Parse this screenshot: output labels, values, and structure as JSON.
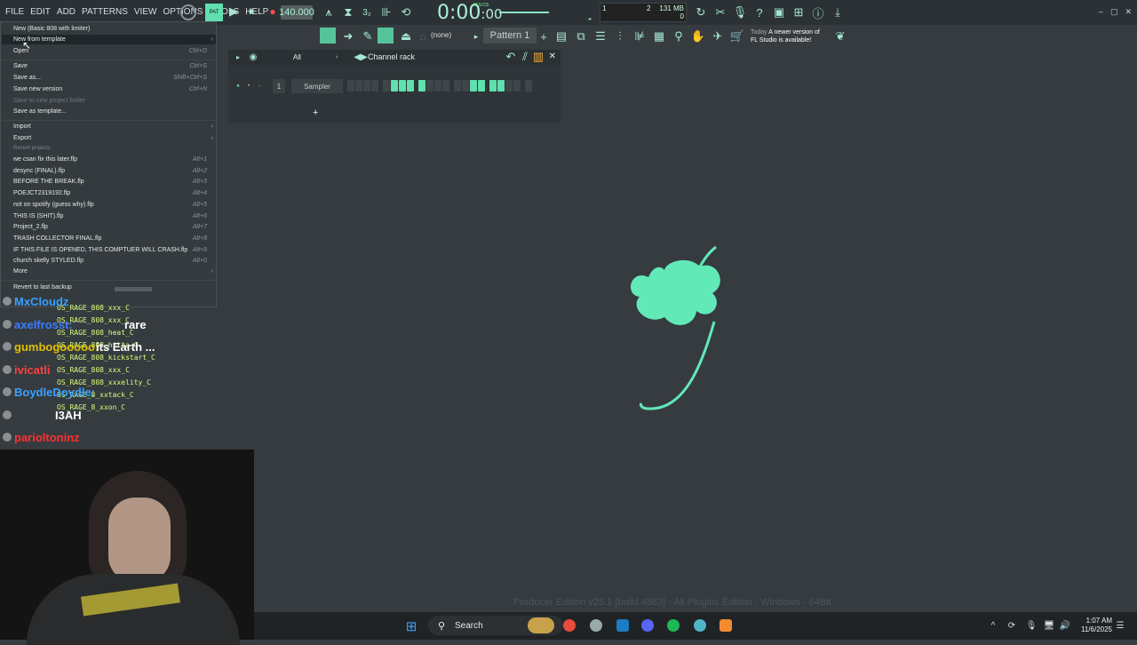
{
  "menubar": {
    "items": [
      "FILE",
      "EDIT",
      "ADD",
      "PATTERNS",
      "VIEW",
      "OPTIONS",
      "TOOLS",
      "HELP"
    ]
  },
  "transport": {
    "tempo": "140.000",
    "time_main": "0:00",
    "time_sub": ":00",
    "time_label": "M:S:CS",
    "cpu_bar": "1",
    "cpu_num": "2",
    "mem": "131 MB",
    "voices": "0"
  },
  "toolbar2": {
    "none_label": "(none)",
    "pattern_label": "Pattern 1",
    "update_today": "Today",
    "update_msg_1": "A newer version of",
    "update_msg_2": "FL Studio is available!"
  },
  "filemenu": {
    "new_basic": "New (Basic 808 with limiter)",
    "new_template": "New from template",
    "open": "Open",
    "open_sc": "Ctrl+O",
    "save": "Save",
    "save_sc": "Ctrl+S",
    "save_as": "Save as...",
    "save_as_sc": "Shift+Ctrl+S",
    "save_new_version": "Save new version",
    "save_new_version_sc": "Ctrl+N",
    "save_new_folder": "Save to new project folder",
    "save_template": "Save as template...",
    "import": "Import",
    "export": "Export",
    "recent_header": "Recent projects",
    "recent": [
      {
        "name": "we csan fix this later.flp",
        "sc": "Alt+1"
      },
      {
        "name": "desync (FINAL).flp",
        "sc": "Alt+2"
      },
      {
        "name": "BEFORE THE BREAK.flp",
        "sc": "Alt+3"
      },
      {
        "name": "POEJCT2319192.flp",
        "sc": "Alt+4"
      },
      {
        "name": "not on spotify (guess why).flp",
        "sc": "Alt+5"
      },
      {
        "name": "THIS IS (SHIT).flp",
        "sc": "Alt+6"
      },
      {
        "name": "Project_2.flp",
        "sc": "Alt+7"
      },
      {
        "name": "TRASH COLLECTOR FINAL.flp",
        "sc": "Alt+8"
      },
      {
        "name": "IF THIS FILE IS OPENED, THIS COMPTUER WILL CRASH.flp",
        "sc": "Alt+9"
      },
      {
        "name": "church skelly STYLED.flp",
        "sc": "Alt+0"
      }
    ],
    "more": "More",
    "revert": "Revert to last backup"
  },
  "channel_rack": {
    "filter": "All",
    "title": "Channel rack",
    "channel_num": "1",
    "channel_name": "Sampler",
    "steps": [
      0,
      0,
      0,
      0,
      0,
      1,
      1,
      1,
      1,
      0,
      0,
      0,
      0,
      0,
      1,
      1,
      1,
      1,
      0,
      0,
      0
    ]
  },
  "watermark": "Producer Edition v25.1 [build 4863] - All Plugins Edition - Windows - 64Bit",
  "chat": {
    "lines": [
      {
        "user": "MxCloudz",
        "msg": "",
        "color": "#3aa0ff"
      },
      {
        "user": "axelfrosst:",
        "msg": "rare",
        "color": "#3a7dff"
      },
      {
        "user": "gumbogooooo:",
        "msg": "its Earth ...",
        "color": "#e0c000"
      },
      {
        "user": "ivicatli",
        "msg": "",
        "color": "#ff4040"
      },
      {
        "user": "BoydleDoydle:",
        "msg": "",
        "color": "#3aa0ff"
      },
      {
        "user": "",
        "msg": "I3AH",
        "color": "#ffffff"
      },
      {
        "user": "parioltoninz",
        "msg": "",
        "color": "#ff3030"
      }
    ],
    "samples": [
      "OS_RAGE_808_xxx_C",
      "OS_RAGE_808_xxx_C",
      "OS_RAGE_808_heat_C",
      "OS_RAGE_808_hitta_C",
      "OS_RAGE_808_kickstart_C",
      "OS_RAGE_808_xxx_C",
      "OS_RAGE_808_xxxelity_C",
      "OS_RAGE_8_xxtack_C",
      "OS_RAGE_8_xxon_C"
    ]
  },
  "taskbar": {
    "search": "Search",
    "time": "1:07 AM",
    "date": "11/6/2025"
  },
  "colors": {
    "accent": "#5fe0ae",
    "logo": "#62e9b8"
  }
}
